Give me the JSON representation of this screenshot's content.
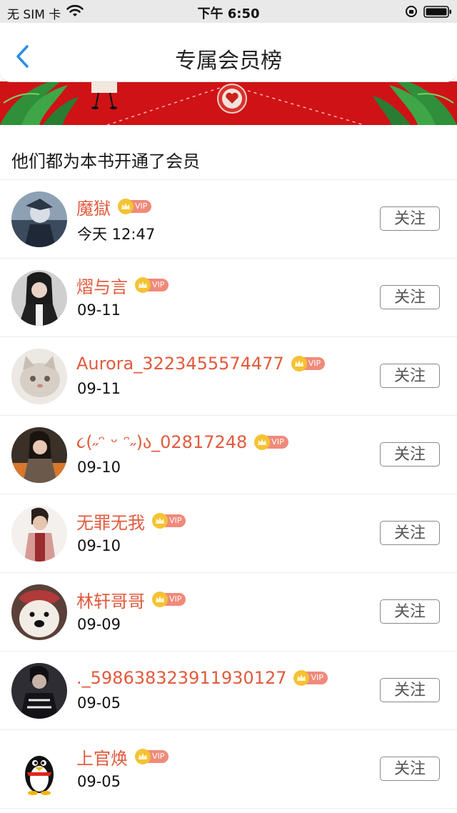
{
  "status_bar": {
    "carrier": "无 SIM 卡",
    "time": "下午 6:50"
  },
  "nav": {
    "title": "专属会员榜"
  },
  "subhead": "他们都为本书开通了会员",
  "vip_label": "VIP",
  "follow_label": "关注",
  "members": [
    {
      "name": "魔獄",
      "date": "今天 12:47"
    },
    {
      "name": "熠与言",
      "date": "09-11"
    },
    {
      "name": "Aurora_3223455574477",
      "date": "09-11"
    },
    {
      "name": "૮(˶ᵔ ᵕ ᵔ˶)ა_02817248",
      "date": "09-10"
    },
    {
      "name": "无罪无我",
      "date": "09-10"
    },
    {
      "name": "林轩哥哥",
      "date": "09-09"
    },
    {
      "name": "._598638323911930127",
      "date": "09-05"
    },
    {
      "name": "上官焕",
      "date": "09-05"
    }
  ],
  "colors": {
    "accent": "#e15a3c",
    "banner": "#cf1216",
    "back": "#2a8ee8",
    "vip_tag": "#f08a7a",
    "crown": "#f4c233"
  }
}
